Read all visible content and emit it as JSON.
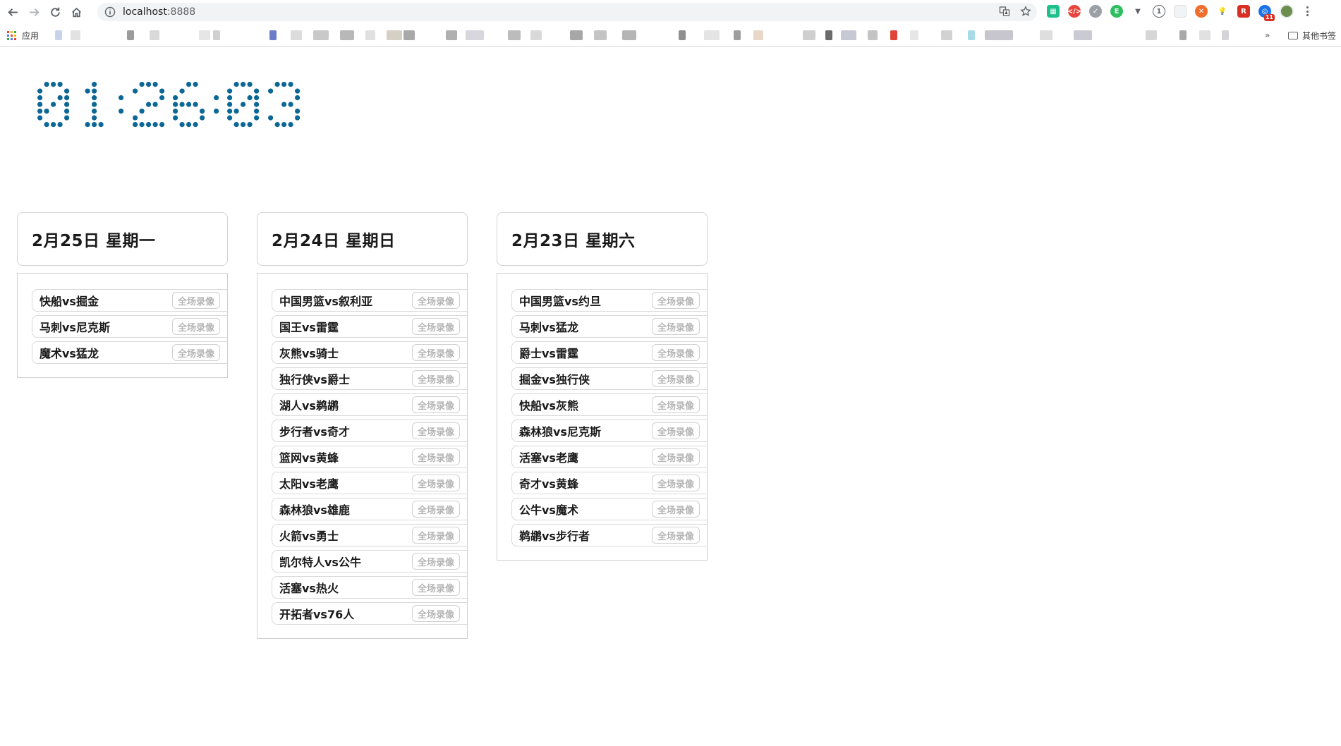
{
  "browser": {
    "url_host": "localhost",
    "url_port": ":8888",
    "apps_label": "应用",
    "other_bookmarks_label": "其他书签",
    "more_bookmarks": "»",
    "extension_badge": "11"
  },
  "clock": {
    "time": "01:26:03",
    "color": "#0b6795"
  },
  "days": [
    {
      "title": "2月25日 星期一",
      "games": [
        {
          "name": "快船vs掘金",
          "button": "全场录像"
        },
        {
          "name": "马刺vs尼克斯",
          "button": "全场录像"
        },
        {
          "name": "魔术vs猛龙",
          "button": "全场录像"
        }
      ]
    },
    {
      "title": "2月24日 星期日",
      "games": [
        {
          "name": "中国男篮vs叙利亚",
          "button": "全场录像"
        },
        {
          "name": "国王vs雷霆",
          "button": "全场录像"
        },
        {
          "name": "灰熊vs骑士",
          "button": "全场录像"
        },
        {
          "name": "独行侠vs爵士",
          "button": "全场录像"
        },
        {
          "name": "湖人vs鹈鹕",
          "button": "全场录像"
        },
        {
          "name": "步行者vs奇才",
          "button": "全场录像"
        },
        {
          "name": "篮网vs黄蜂",
          "button": "全场录像"
        },
        {
          "name": "太阳vs老鹰",
          "button": "全场录像"
        },
        {
          "name": "森林狼vs雄鹿",
          "button": "全场录像"
        },
        {
          "name": "火箭vs勇士",
          "button": "全场录像"
        },
        {
          "name": "凯尔特人vs公牛",
          "button": "全场录像"
        },
        {
          "name": "活塞vs热火",
          "button": "全场录像"
        },
        {
          "name": "开拓者vs76人",
          "button": "全场录像"
        }
      ]
    },
    {
      "title": "2月23日 星期六",
      "games": [
        {
          "name": "中国男篮vs约旦",
          "button": "全场录像"
        },
        {
          "name": "马刺vs猛龙",
          "button": "全场录像"
        },
        {
          "name": "爵士vs雷霆",
          "button": "全场录像"
        },
        {
          "name": "掘金vs独行侠",
          "button": "全场录像"
        },
        {
          "name": "快船vs灰熊",
          "button": "全场录像"
        },
        {
          "name": "森林狼vs尼克斯",
          "button": "全场录像"
        },
        {
          "name": "活塞vs老鹰",
          "button": "全场录像"
        },
        {
          "name": "奇才vs黄蜂",
          "button": "全场录像"
        },
        {
          "name": "公牛vs魔术",
          "button": "全场录像"
        },
        {
          "name": "鹈鹕vs步行者",
          "button": "全场录像"
        }
      ]
    }
  ]
}
